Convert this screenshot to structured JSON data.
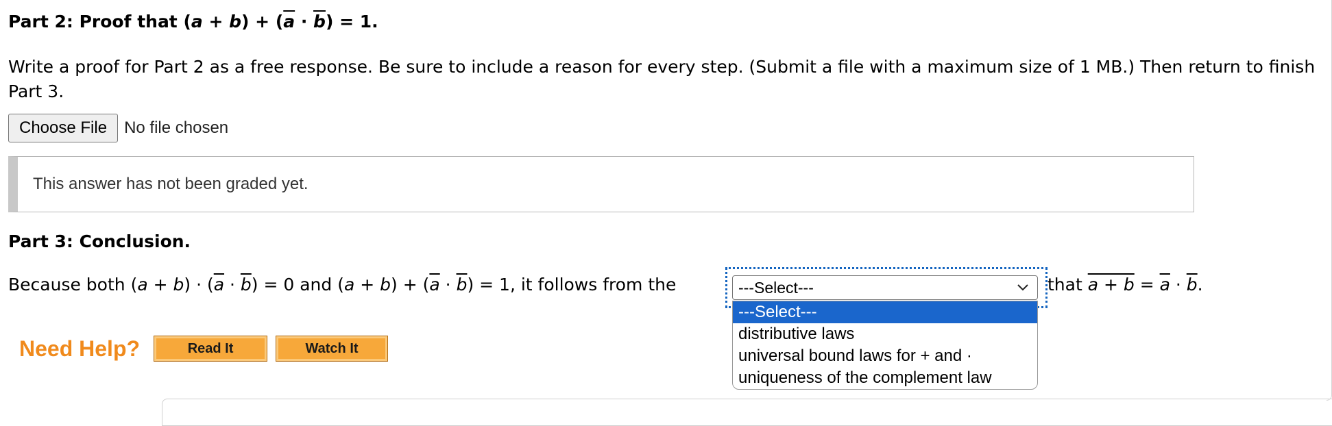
{
  "part2": {
    "title_prefix": "Part 2",
    "title_sep": ": ",
    "title_text": "Proof that ",
    "title_formula": {
      "open": "(",
      "a": "a",
      "plus": " + ",
      "b": "b",
      "close_plus": ") + (",
      "a_bar": "a",
      "dot": " · ",
      "b_bar": "b",
      "end": ") = 1."
    },
    "instructions": "Write a proof for Part 2 as a free response. Be sure to include a reason for every step. (Submit a file with a maximum size of 1 MB.) Then return to finish Part 3.",
    "choose_file_label": "Choose File",
    "no_file_text": "No file chosen",
    "graded_status": "This answer has not been graded yet."
  },
  "part3": {
    "title_prefix": "Part 3",
    "title_sep": ": ",
    "title_text": "Conclusion.",
    "sentence_start": "Because both ",
    "f1": {
      "open": "(",
      "a": "a",
      "plus": " + ",
      "b": "b",
      "mid": ") · (",
      "a_bar": "a",
      "dot": " · ",
      "b_bar": "b",
      "end": ") = 0"
    },
    "and_text": " and ",
    "f2": {
      "open": "(",
      "a": "a",
      "plus": " + ",
      "b": "b",
      "mid": ") + (",
      "a_bar": "a",
      "dot": " · ",
      "b_bar": "b",
      "end": ") = 1"
    },
    "follows_text": ", it follows from the",
    "select": {
      "selected": "---Select---",
      "options": [
        "---Select---",
        "distributive laws",
        "universal bound laws for + and ·",
        "uniqueness of the complement law"
      ]
    },
    "after": {
      "that": "that ",
      "ab": "a + b",
      "eq": " = ",
      "a_bar": "a",
      "dot": " · ",
      "b_bar": "b",
      "end": "."
    }
  },
  "help": {
    "label": "Need Help?",
    "read_it": "Read It",
    "watch_it": "Watch It"
  }
}
